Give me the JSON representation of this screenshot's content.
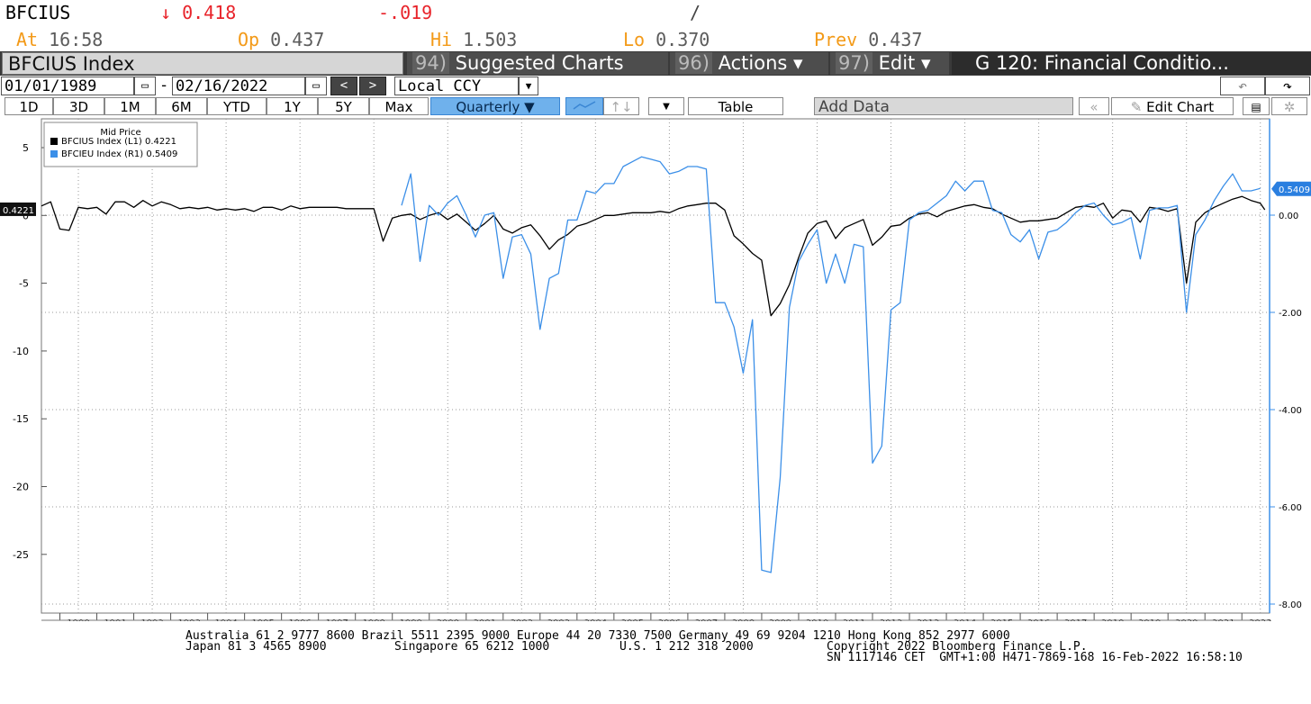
{
  "quote": {
    "ticker": "BFCIUS",
    "last": "↓ 0.418",
    "change": ".019",
    "change_prefix": "-",
    "slash": "/",
    "at_label": "At",
    "at_value": "16:58",
    "op_label": "Op",
    "op_value": "0.437",
    "hi_label": "Hi",
    "hi_value": "1.503",
    "lo_label": "Lo",
    "lo_value": "0.370",
    "prev_label": "Prev",
    "prev_value": "0.437"
  },
  "titlebar": {
    "index": "BFCIUS Index",
    "suggested_num": "94)",
    "suggested": "Suggested Charts",
    "actions_num": "96)",
    "actions": "Actions ▾",
    "edit_num": "97)",
    "edit": "Edit ▾",
    "function": "G 120: Financial Conditio..."
  },
  "daterow": {
    "start": "01/01/1989",
    "sep": "-",
    "end": "02/16/2022",
    "prev": "<",
    "next": ">",
    "currency": "Local CCY",
    "undo": "↶",
    "redo": "↷"
  },
  "toolbar": {
    "periods": [
      "1D",
      "3D",
      "1M",
      "6M",
      "YTD",
      "1Y",
      "5Y",
      "Max"
    ],
    "frequency": "Quarterly ▼",
    "table": "Table",
    "add_data": "Add Data",
    "edit_chart": "Edit Chart",
    "collapse": "«"
  },
  "colors": {
    "series_us": "#000000",
    "series_eu": "#3b8fe8",
    "grid": "#999999"
  },
  "chart_data": {
    "type": "line",
    "legend": {
      "title": "Mid Price",
      "entries": [
        "BFCIUS Index  (L1) 0.4221",
        "BFCIEU Index  (R1) 0.5409"
      ]
    },
    "left_axis": {
      "ticks": [
        5,
        0,
        -5,
        -10,
        -15,
        -20,
        -25
      ],
      "tick_labels": [
        "5",
        "0",
        "-5",
        "-10",
        "-15",
        "-20",
        "-25"
      ],
      "range": [
        -28.7,
        6
      ]
    },
    "right_axis": {
      "ticks": [
        0,
        -2,
        -4,
        -6,
        -8
      ],
      "tick_labels": [
        "0.00",
        "-2.00",
        "-4.00",
        "-6.00",
        "-8.00"
      ],
      "range": [
        -8.2,
        2.15
      ]
    },
    "x_labels": [
      "1990",
      "1991",
      "1992",
      "1993",
      "1994",
      "1995",
      "1996",
      "1997",
      "1998",
      "1999",
      "2000",
      "2001",
      "2002",
      "2003",
      "2004",
      "2005",
      "2006",
      "2007",
      "2008",
      "2009",
      "2010",
      "2011",
      "2012",
      "2013",
      "2014",
      "2015",
      "2016",
      "2017",
      "2018",
      "2019",
      "2020",
      "2021",
      "2022"
    ],
    "last_value_labels": {
      "left": "0.4221",
      "right": "0.5409"
    },
    "series": [
      {
        "name": "BFCIUS Index",
        "axis": "left",
        "points": [
          [
            1989.0,
            0.7
          ],
          [
            1989.25,
            1.0
          ],
          [
            1989.5,
            -1.0
          ],
          [
            1989.75,
            -1.1
          ],
          [
            1990.0,
            0.6
          ],
          [
            1990.25,
            0.5
          ],
          [
            1990.5,
            0.6
          ],
          [
            1990.75,
            0.1
          ],
          [
            1991.0,
            1.0
          ],
          [
            1991.25,
            1.0
          ],
          [
            1991.5,
            0.6
          ],
          [
            1991.75,
            1.1
          ],
          [
            1992.0,
            0.7
          ],
          [
            1992.25,
            1.0
          ],
          [
            1992.5,
            0.8
          ],
          [
            1992.75,
            0.5
          ],
          [
            1993.0,
            0.6
          ],
          [
            1993.25,
            0.5
          ],
          [
            1993.5,
            0.6
          ],
          [
            1993.75,
            0.4
          ],
          [
            1994.0,
            0.5
          ],
          [
            1994.25,
            0.4
          ],
          [
            1994.5,
            0.5
          ],
          [
            1994.75,
            0.3
          ],
          [
            1995.0,
            0.6
          ],
          [
            1995.25,
            0.6
          ],
          [
            1995.5,
            0.4
          ],
          [
            1995.75,
            0.7
          ],
          [
            1996.0,
            0.5
          ],
          [
            1996.25,
            0.6
          ],
          [
            1996.5,
            0.6
          ],
          [
            1996.75,
            0.6
          ],
          [
            1997.0,
            0.6
          ],
          [
            1997.25,
            0.5
          ],
          [
            1997.5,
            0.5
          ],
          [
            1997.75,
            0.5
          ],
          [
            1998.0,
            0.5
          ],
          [
            1998.25,
            -1.9
          ],
          [
            1998.5,
            -0.2
          ],
          [
            1998.75,
            0.0
          ],
          [
            1999.0,
            0.1
          ],
          [
            1999.25,
            -0.3
          ],
          [
            1999.5,
            0.0
          ],
          [
            1999.75,
            0.2
          ],
          [
            2000.0,
            -0.3
          ],
          [
            2000.25,
            0.1
          ],
          [
            2000.5,
            -0.5
          ],
          [
            2000.75,
            -1.1
          ],
          [
            2001.0,
            -0.6
          ],
          [
            2001.25,
            0.0
          ],
          [
            2001.5,
            -1.0
          ],
          [
            2001.75,
            -1.3
          ],
          [
            2002.0,
            -0.9
          ],
          [
            2002.25,
            -0.7
          ],
          [
            2002.5,
            -1.5
          ],
          [
            2002.75,
            -2.5
          ],
          [
            2003.0,
            -1.8
          ],
          [
            2003.25,
            -1.4
          ],
          [
            2003.5,
            -0.8
          ],
          [
            2003.75,
            -0.6
          ],
          [
            2004.0,
            -0.3
          ],
          [
            2004.25,
            0.0
          ],
          [
            2004.5,
            0.0
          ],
          [
            2004.75,
            0.1
          ],
          [
            2005.0,
            0.2
          ],
          [
            2005.25,
            0.2
          ],
          [
            2005.5,
            0.2
          ],
          [
            2005.75,
            0.3
          ],
          [
            2006.0,
            0.2
          ],
          [
            2006.25,
            0.5
          ],
          [
            2006.5,
            0.7
          ],
          [
            2006.75,
            0.8
          ],
          [
            2007.0,
            0.9
          ],
          [
            2007.25,
            0.9
          ],
          [
            2007.5,
            0.4
          ],
          [
            2007.75,
            -1.5
          ],
          [
            2008.0,
            -2.1
          ],
          [
            2008.25,
            -2.8
          ],
          [
            2008.5,
            -3.3
          ],
          [
            2008.75,
            -7.4
          ],
          [
            2009.0,
            -6.5
          ],
          [
            2009.25,
            -5.1
          ],
          [
            2009.5,
            -3.1
          ],
          [
            2009.75,
            -1.3
          ],
          [
            2010.0,
            -0.6
          ],
          [
            2010.25,
            -0.4
          ],
          [
            2010.5,
            -1.7
          ],
          [
            2010.75,
            -0.9
          ],
          [
            2011.0,
            -0.6
          ],
          [
            2011.25,
            -0.3
          ],
          [
            2011.5,
            -2.2
          ],
          [
            2011.75,
            -1.6
          ],
          [
            2012.0,
            -0.8
          ],
          [
            2012.25,
            -0.7
          ],
          [
            2012.5,
            -0.2
          ],
          [
            2012.75,
            0.1
          ],
          [
            2013.0,
            0.2
          ],
          [
            2013.25,
            -0.1
          ],
          [
            2013.5,
            0.3
          ],
          [
            2013.75,
            0.5
          ],
          [
            2014.0,
            0.7
          ],
          [
            2014.25,
            0.8
          ],
          [
            2014.5,
            0.6
          ],
          [
            2014.75,
            0.5
          ],
          [
            2015.0,
            0.1
          ],
          [
            2015.25,
            -0.2
          ],
          [
            2015.5,
            -0.5
          ],
          [
            2015.75,
            -0.4
          ],
          [
            2016.0,
            -0.4
          ],
          [
            2016.25,
            -0.3
          ],
          [
            2016.5,
            -0.2
          ],
          [
            2016.75,
            0.2
          ],
          [
            2017.0,
            0.6
          ],
          [
            2017.25,
            0.7
          ],
          [
            2017.5,
            0.6
          ],
          [
            2017.75,
            0.9
          ],
          [
            2018.0,
            -0.2
          ],
          [
            2018.25,
            0.4
          ],
          [
            2018.5,
            0.3
          ],
          [
            2018.75,
            -0.5
          ],
          [
            2019.0,
            0.6
          ],
          [
            2019.25,
            0.5
          ],
          [
            2019.5,
            0.3
          ],
          [
            2019.75,
            0.5
          ],
          [
            2020.0,
            -5.0
          ],
          [
            2020.25,
            -0.5
          ],
          [
            2020.5,
            0.2
          ],
          [
            2020.75,
            0.6
          ],
          [
            2021.0,
            0.9
          ],
          [
            2021.25,
            1.2
          ],
          [
            2021.5,
            1.4
          ],
          [
            2021.75,
            1.1
          ],
          [
            2022.0,
            0.9
          ],
          [
            2022.12,
            0.42
          ]
        ]
      },
      {
        "name": "BFCIEU Index",
        "axis": "right",
        "points": [
          [
            1998.75,
            0.2
          ],
          [
            1999.0,
            0.85
          ],
          [
            1999.25,
            -0.95
          ],
          [
            1999.5,
            0.2
          ],
          [
            1999.75,
            0.0
          ],
          [
            2000.0,
            0.25
          ],
          [
            2000.25,
            0.4
          ],
          [
            2000.5,
            0.0
          ],
          [
            2000.75,
            -0.45
          ],
          [
            2001.0,
            0.0
          ],
          [
            2001.25,
            0.05
          ],
          [
            2001.5,
            -1.3
          ],
          [
            2001.75,
            -0.45
          ],
          [
            2002.0,
            -0.4
          ],
          [
            2002.25,
            -0.8
          ],
          [
            2002.5,
            -2.35
          ],
          [
            2002.75,
            -1.3
          ],
          [
            2003.0,
            -1.2
          ],
          [
            2003.25,
            -0.1
          ],
          [
            2003.5,
            -0.1
          ],
          [
            2003.75,
            0.5
          ],
          [
            2004.0,
            0.45
          ],
          [
            2004.25,
            0.65
          ],
          [
            2004.5,
            0.65
          ],
          [
            2004.75,
            1.0
          ],
          [
            2005.0,
            1.1
          ],
          [
            2005.25,
            1.2
          ],
          [
            2005.5,
            1.15
          ],
          [
            2005.75,
            1.1
          ],
          [
            2006.0,
            0.85
          ],
          [
            2006.25,
            0.9
          ],
          [
            2006.5,
            1.0
          ],
          [
            2006.75,
            1.0
          ],
          [
            2007.0,
            0.95
          ],
          [
            2007.25,
            -1.8
          ],
          [
            2007.5,
            -1.8
          ],
          [
            2007.75,
            -2.3
          ],
          [
            2008.0,
            -3.25
          ],
          [
            2008.25,
            -2.15
          ],
          [
            2008.5,
            -7.3
          ],
          [
            2008.75,
            -7.35
          ],
          [
            2009.0,
            -5.4
          ],
          [
            2009.25,
            -1.9
          ],
          [
            2009.5,
            -0.95
          ],
          [
            2009.75,
            -0.6
          ],
          [
            2010.0,
            -0.3
          ],
          [
            2010.25,
            -1.4
          ],
          [
            2010.5,
            -0.8
          ],
          [
            2010.75,
            -1.4
          ],
          [
            2011.0,
            -0.6
          ],
          [
            2011.25,
            -0.65
          ],
          [
            2011.5,
            -5.1
          ],
          [
            2011.75,
            -4.75
          ],
          [
            2012.0,
            -1.95
          ],
          [
            2012.25,
            -1.8
          ],
          [
            2012.5,
            -0.1
          ],
          [
            2012.75,
            0.05
          ],
          [
            2013.0,
            0.1
          ],
          [
            2013.25,
            0.25
          ],
          [
            2013.5,
            0.4
          ],
          [
            2013.75,
            0.7
          ],
          [
            2014.0,
            0.5
          ],
          [
            2014.25,
            0.7
          ],
          [
            2014.5,
            0.7
          ],
          [
            2014.75,
            0.1
          ],
          [
            2015.0,
            0.05
          ],
          [
            2015.25,
            -0.4
          ],
          [
            2015.5,
            -0.55
          ],
          [
            2015.75,
            -0.3
          ],
          [
            2016.0,
            -0.9
          ],
          [
            2016.25,
            -0.35
          ],
          [
            2016.5,
            -0.3
          ],
          [
            2016.75,
            -0.15
          ],
          [
            2017.0,
            0.05
          ],
          [
            2017.25,
            0.2
          ],
          [
            2017.5,
            0.25
          ],
          [
            2017.75,
            0.0
          ],
          [
            2018.0,
            -0.2
          ],
          [
            2018.25,
            -0.15
          ],
          [
            2018.5,
            -0.05
          ],
          [
            2018.75,
            -0.9
          ],
          [
            2019.0,
            0.1
          ],
          [
            2019.25,
            0.15
          ],
          [
            2019.5,
            0.15
          ],
          [
            2019.75,
            0.2
          ],
          [
            2020.0,
            -2.0
          ],
          [
            2020.25,
            -0.4
          ],
          [
            2020.5,
            -0.1
          ],
          [
            2020.75,
            0.3
          ],
          [
            2021.0,
            0.6
          ],
          [
            2021.25,
            0.85
          ],
          [
            2021.5,
            0.5
          ],
          [
            2021.75,
            0.5
          ],
          [
            2022.0,
            0.55
          ]
        ]
      }
    ]
  },
  "footer": {
    "line1": "Australia 61 2 9777 8600 Brazil 5511 2395 9000 Europe 44 20 7330 7500 Germany 49 69 9204 1210 Hong Kong 852 2977 6000",
    "line2a": "Japan 81 3 4565 8900",
    "line2b": "Singapore 65 6212 1000",
    "line2c": "U.S. 1 212 318 2000",
    "line2d": "Copyright 2022 Bloomberg Finance L.P.",
    "line3": "SN 1117146 CET  GMT+1:00 H471-7869-168 16-Feb-2022 16:58:10"
  }
}
